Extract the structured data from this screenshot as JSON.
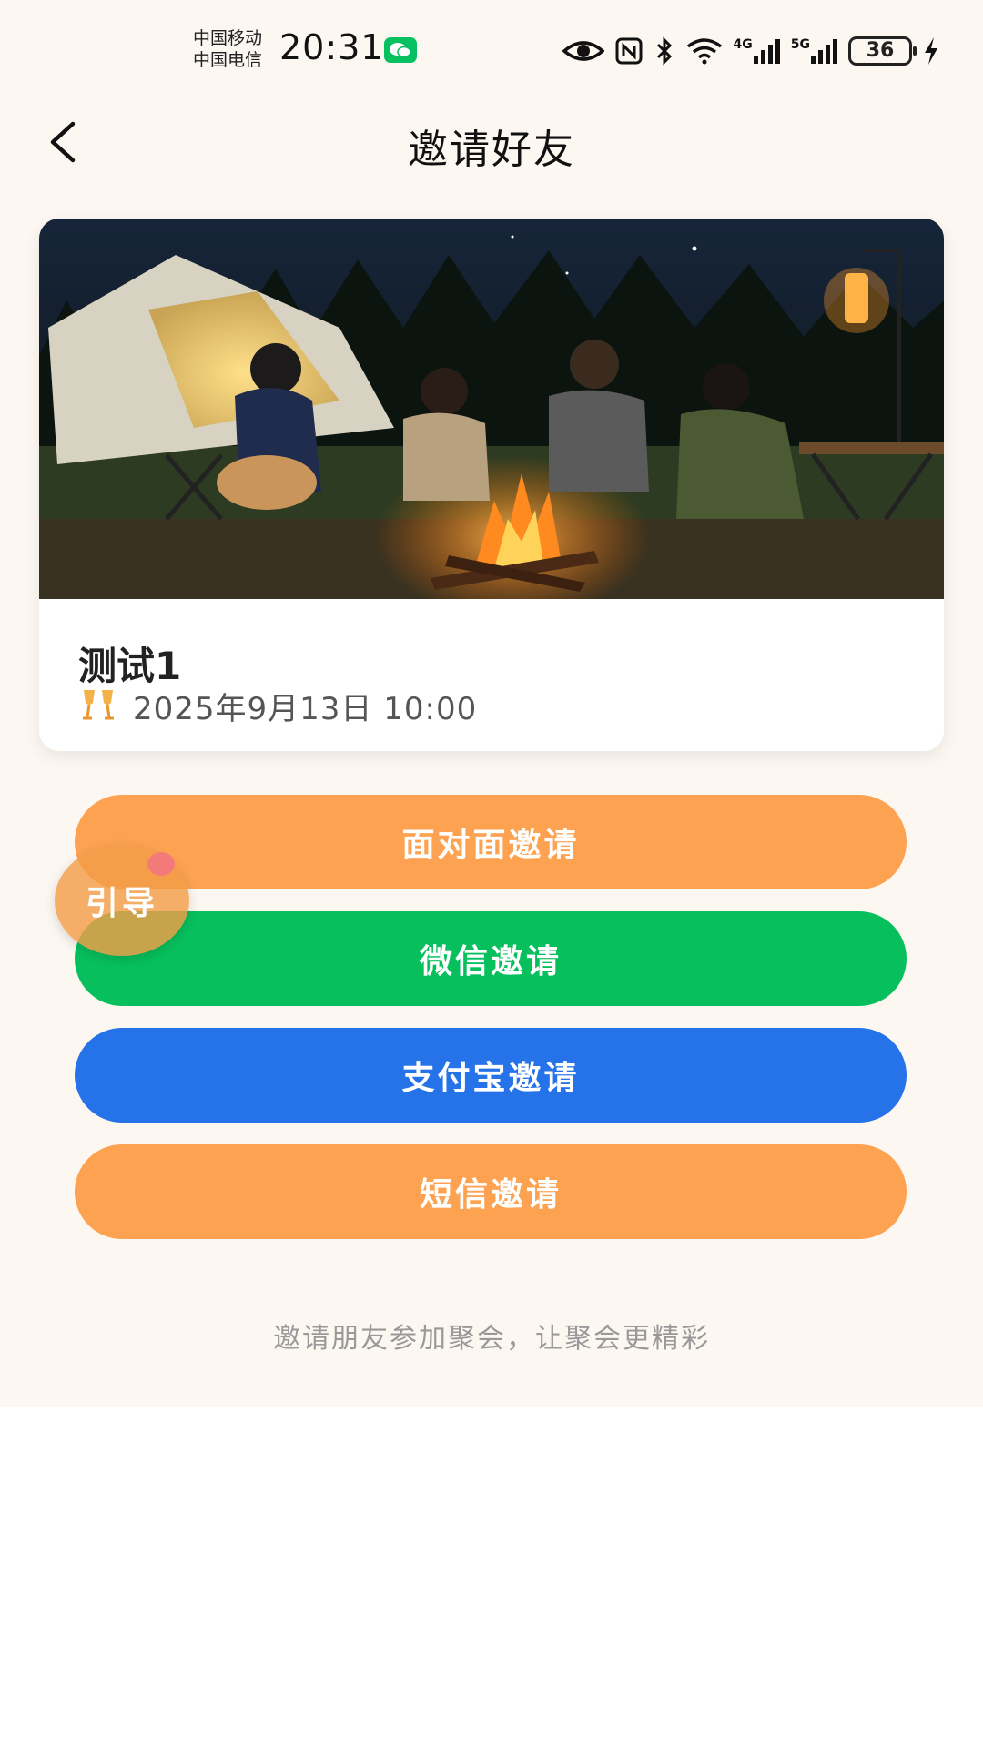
{
  "status_bar": {
    "carrier_1": "中国移动",
    "carrier_2": "中国电信",
    "time": "20:31",
    "network_4g": "4G",
    "network_5g": "5G",
    "battery": "36"
  },
  "header": {
    "title": "邀请好友"
  },
  "event": {
    "name": "测试1",
    "time": "2025年9月13日 10:00",
    "icon": "cheers-icon"
  },
  "buttons": {
    "face_to_face": "面对面邀请",
    "wechat": "微信邀请",
    "alipay": "支付宝邀请",
    "sms": "短信邀请"
  },
  "guide": {
    "label": "引导"
  },
  "footer": {
    "text": "邀请朋友参加聚会，让聚会更精彩"
  },
  "colors": {
    "orange": "#fda251",
    "wechat_green": "#07c05d",
    "alipay_blue": "#2672e8",
    "background": "#fdf7f2"
  }
}
